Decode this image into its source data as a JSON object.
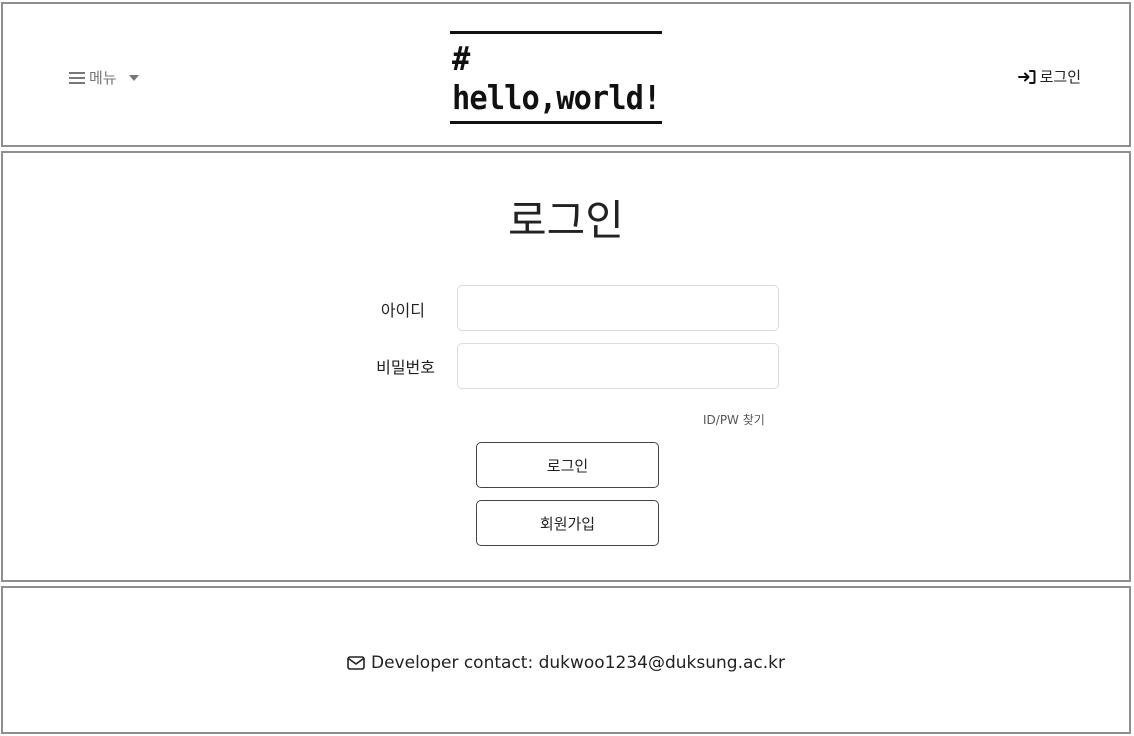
{
  "header": {
    "menu_label": "메뉴",
    "logo_text": "# hello,world!",
    "login_link": "로그인"
  },
  "main": {
    "title": "로그인",
    "id_label": "아이디",
    "password_label": "비밀번호",
    "id_value": "",
    "password_value": "",
    "find_link": "ID/PW 찾기",
    "login_button": "로그인",
    "signup_button": "회원가입"
  },
  "footer": {
    "contact_text": "Developer contact: dukwoo1234@duksung.ac.kr"
  },
  "icons": {
    "menu": "hamburger-icon",
    "menu_caret": "caret-down-icon",
    "login": "sign-in-icon",
    "contact": "envelope-icon"
  }
}
